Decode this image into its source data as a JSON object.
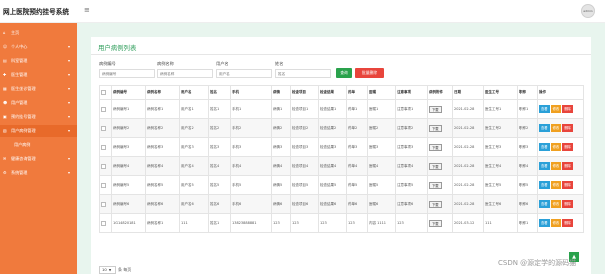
{
  "app": {
    "title": "网上医院预约挂号系统",
    "menu_toggle_icon": "hamburger-icon",
    "avatar_text": "admin"
  },
  "sidebar": {
    "items": [
      {
        "label": "主页",
        "icon": "home-icon",
        "has_arrow": false,
        "highlighted": false
      },
      {
        "label": "个人中心",
        "icon": "person-icon",
        "has_arrow": true,
        "highlighted": false
      },
      {
        "label": "科室管理",
        "icon": "folder-icon",
        "has_arrow": true,
        "highlighted": false
      },
      {
        "label": "医生管理",
        "icon": "doctor-icon",
        "has_arrow": true,
        "highlighted": false
      },
      {
        "label": "医生坐诊管理",
        "icon": "calendar-icon",
        "has_arrow": true,
        "highlighted": false
      },
      {
        "label": "用户管理",
        "icon": "users-icon",
        "has_arrow": true,
        "highlighted": false
      },
      {
        "label": "预约挂号管理",
        "icon": "ticket-icon",
        "has_arrow": true,
        "highlighted": false
      },
      {
        "label": "用户病例管理",
        "icon": "record-icon",
        "has_arrow": true,
        "highlighted": true
      },
      {
        "label": "用户病例",
        "icon": "",
        "has_arrow": false,
        "highlighted": false,
        "sub": true
      },
      {
        "label": "健康咨询管理",
        "icon": "chat-icon",
        "has_arrow": true,
        "highlighted": false
      },
      {
        "label": "系统管理",
        "icon": "settings-icon",
        "has_arrow": true,
        "highlighted": false
      }
    ]
  },
  "main": {
    "title": "用户病例列表",
    "search": {
      "fields": [
        {
          "label": "病例编号",
          "placeholder": "病例编号"
        },
        {
          "label": "病例名称",
          "placeholder": "病例名称"
        },
        {
          "label": "用户名",
          "placeholder": "用户名"
        },
        {
          "label": "姓名",
          "placeholder": "姓名"
        }
      ],
      "search_label": "查询",
      "batch_delete_label": "批量删除"
    },
    "table": {
      "columns": [
        "",
        "病例编号",
        "病例名称",
        "用户名",
        "姓名",
        "手机",
        "病情",
        "检查项目",
        "检查结果",
        "药单",
        "医嘱",
        "注意事项",
        "病例附件",
        "日期",
        "医生工号",
        "职称",
        "操作"
      ],
      "download_label": "下载",
      "actions": {
        "view": "查看",
        "edit": "修改",
        "delete": "删除"
      },
      "rows": [
        [
          "病例编号1",
          "病例名称1",
          "用户名1",
          "姓名1",
          "手机1",
          "病情1",
          "检查项目1",
          "检查结果1",
          "药单1",
          "医嘱1",
          "注意事项1",
          "2021-02-28",
          "医生工号1",
          "职称1"
        ],
        [
          "病例编号2",
          "病例名称2",
          "用户名2",
          "姓名2",
          "手机2",
          "病情2",
          "检查项目2",
          "检查结果2",
          "药单2",
          "医嘱2",
          "注意事项2",
          "2021-02-28",
          "医生工号2",
          "职称2"
        ],
        [
          "病例编号3",
          "病例名称3",
          "用户名3",
          "姓名3",
          "手机3",
          "病情3",
          "检查项目3",
          "检查结果3",
          "药单3",
          "医嘱3",
          "注意事项3",
          "2021-02-28",
          "医生工号3",
          "职称3"
        ],
        [
          "病例编号4",
          "病例名称4",
          "用户名4",
          "姓名4",
          "手机4",
          "病情4",
          "检查项目4",
          "检查结果4",
          "药单4",
          "医嘱4",
          "注意事项4",
          "2021-02-28",
          "医生工号4",
          "职称4"
        ],
        [
          "病例编号5",
          "病例名称5",
          "用户名5",
          "姓名5",
          "手机5",
          "病情5",
          "检查项目5",
          "检查结果5",
          "药单5",
          "医嘱5",
          "注意事项5",
          "2021-02-28",
          "医生工号5",
          "职称5"
        ],
        [
          "病例编号6",
          "病例名称6",
          "用户名6",
          "姓名6",
          "手机6",
          "病情6",
          "检查项目6",
          "检查结果6",
          "药单6",
          "医嘱6",
          "注意事项6",
          "2021-02-28",
          "医生工号6",
          "职称6"
        ],
        [
          "1G14820181",
          "病例名称1",
          "111",
          "姓名1",
          "13823888881",
          "123",
          "123",
          "123",
          "123",
          "内容 1111",
          "123",
          "2021-03-12",
          "111",
          "职称1"
        ]
      ]
    },
    "pager": {
      "page_size": "10",
      "per_page_label": "条 每页"
    }
  },
  "colors": {
    "sidebar": "#f07a3d",
    "content_bg": "#e8f5ee",
    "accent_green": "#2aa24c",
    "danger_red": "#e8453c",
    "view_blue": "#2aa0d8",
    "edit_orange": "#f0a020"
  },
  "watermark": "CSDN @源定学的源码猫"
}
